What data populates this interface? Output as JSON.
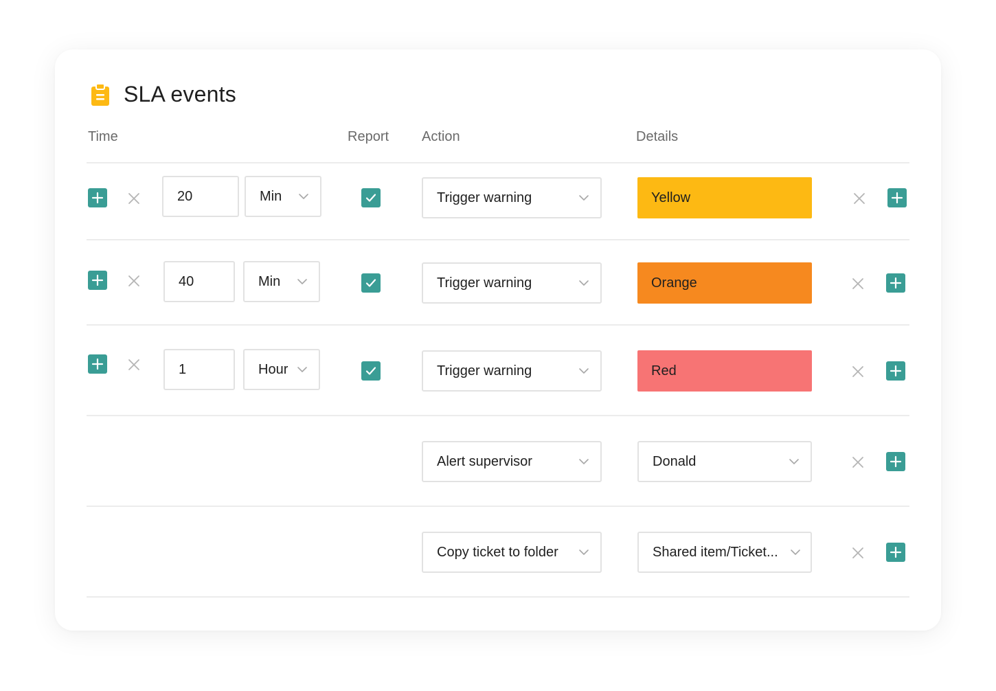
{
  "header": {
    "title": "SLA events",
    "icon": "clipboard-icon",
    "icon_color": "#fdb913"
  },
  "columns": {
    "time": "Time",
    "report": "Report",
    "action": "Action",
    "details": "Details"
  },
  "colors": {
    "accent": "#3a9d95",
    "yellow": "#fdb913",
    "orange": "#f6891f",
    "red": "#f77474"
  },
  "rows": [
    {
      "time_value": "20",
      "unit": "Min",
      "report": true,
      "action": "Trigger warning",
      "details": "Yellow"
    },
    {
      "time_value": "40",
      "unit": "Min",
      "report": true,
      "action": "Trigger warning",
      "details": "Orange"
    },
    {
      "time_value": "1",
      "unit": "Hour",
      "report": true,
      "action": "Trigger warning",
      "details": "Red"
    },
    {
      "action": "Alert supervisor",
      "details": "Donald"
    },
    {
      "action": "Copy ticket to folder",
      "details": "Shared item/Ticket..."
    }
  ]
}
